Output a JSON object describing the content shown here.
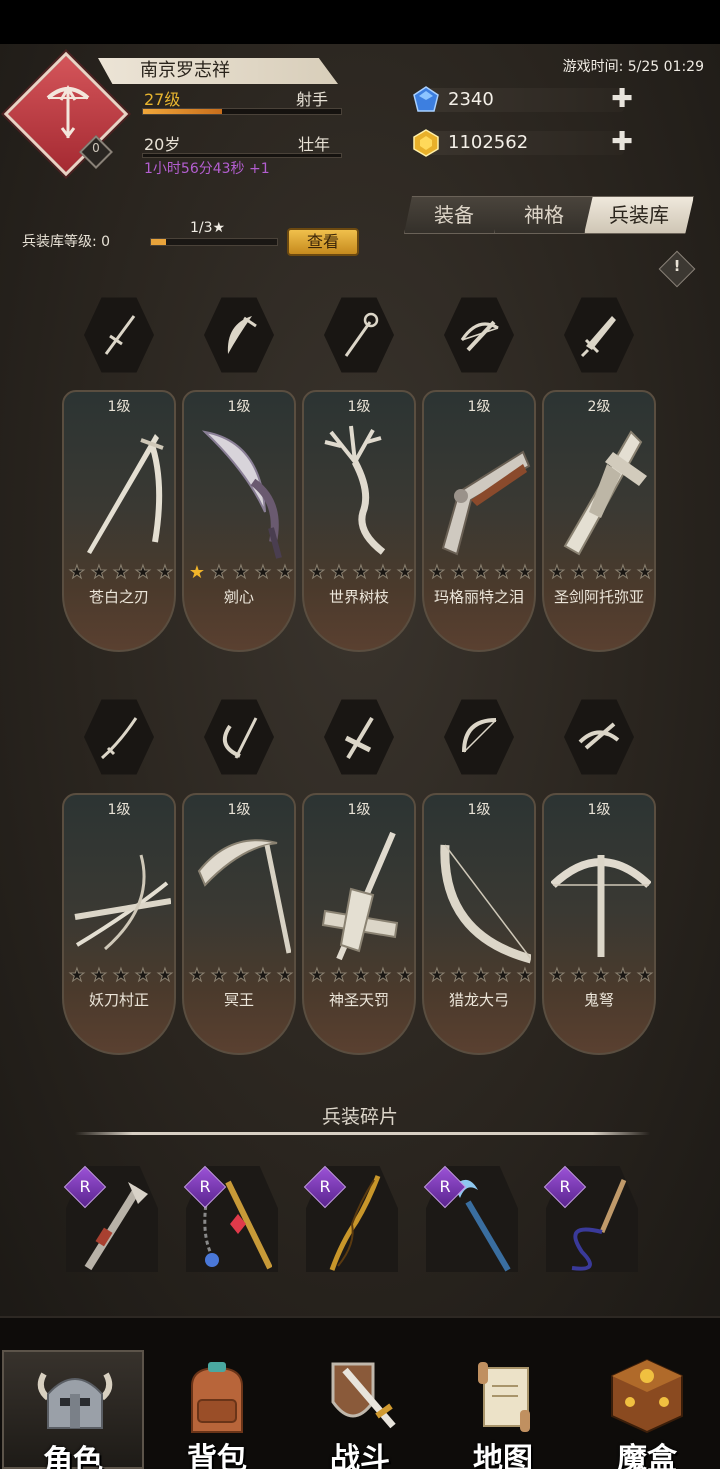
{
  "header": {
    "player_name": "南京罗志祥",
    "emblem_badge": "0",
    "level": "27级",
    "class": "射手",
    "xp_fraction": 0.4,
    "age": "20岁",
    "life_stage": "壮年",
    "age_timer": "1小时56分43秒 +1",
    "game_time": "游戏时间: 5/25 01:29"
  },
  "currency": {
    "gems": "2340",
    "gold": "1102562",
    "plus": "✚"
  },
  "tabs": {
    "equipment": "装备",
    "divinity": "神格",
    "armory": "兵装库"
  },
  "armory": {
    "level_label": "兵装库等级: 0",
    "progress": "1/3★",
    "progress_fraction": 0.12,
    "view_button": "查看",
    "info": "!"
  },
  "weapons_row1": [
    {
      "level": "1级",
      "name": "苍白之刃",
      "stars": 0
    },
    {
      "level": "1级",
      "name": "剜心",
      "stars": 1
    },
    {
      "level": "1级",
      "name": "世界树枝",
      "stars": 0
    },
    {
      "level": "1级",
      "name": "玛格丽特之泪",
      "stars": 0
    },
    {
      "level": "2级",
      "name": "圣剑阿托弥亚",
      "stars": 0
    }
  ],
  "weapons_row2": [
    {
      "level": "1级",
      "name": "妖刀村正",
      "stars": 0
    },
    {
      "level": "1级",
      "name": "冥王",
      "stars": 0
    },
    {
      "level": "1级",
      "name": "神圣天罚",
      "stars": 0
    },
    {
      "level": "1级",
      "name": "猎龙大弓",
      "stars": 0
    },
    {
      "level": "1级",
      "name": "鬼弩",
      "stars": 0
    }
  ],
  "weapon_type_icons_row1": [
    "sword-icon",
    "dagger-icon",
    "staff-icon",
    "crossbow-icon",
    "greatsword-icon"
  ],
  "weapon_type_icons_row2": [
    "katana-icon",
    "scythe-icon",
    "cross-sword-icon",
    "bow-icon",
    "crossbow-icon"
  ],
  "fragments": {
    "title": "兵装碎片",
    "rarity": "R",
    "items": [
      "axe-gun-icon",
      "chain-mace-icon",
      "twisted-spear-icon",
      "moon-staff-icon",
      "whip-icon"
    ]
  },
  "nav": {
    "character": "角色",
    "bag": "背包",
    "battle": "战斗",
    "map": "地图",
    "magic_box": "魔盒"
  },
  "colors": {
    "accent_gold": "#e7b52f",
    "emblem_red": "#c84048",
    "timer_purple": "#b35ed0",
    "rarity_purple": "#7d3ab8"
  }
}
